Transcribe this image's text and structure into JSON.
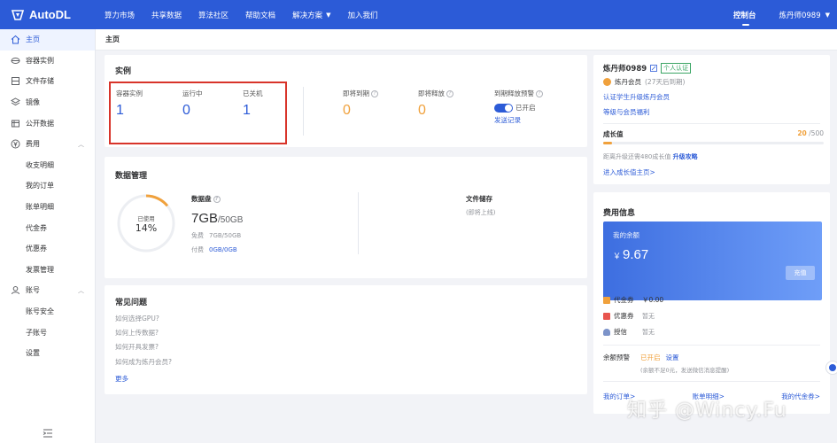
{
  "app": {
    "name": "AutoDL"
  },
  "nav": [
    "算力市场",
    "共享数据",
    "算法社区",
    "帮助文档",
    "解决方案",
    "加入我们"
  ],
  "topbar": {
    "console": "控制台",
    "user": "炼丹师0989"
  },
  "sidebar": {
    "items": [
      {
        "label": "主页",
        "icon": "home-icon"
      },
      {
        "label": "容器实例",
        "icon": "container-icon"
      },
      {
        "label": "文件存储",
        "icon": "storage-icon"
      },
      {
        "label": "镜像",
        "icon": "image-icon"
      },
      {
        "label": "公开数据",
        "icon": "database-icon"
      },
      {
        "label": "费用",
        "icon": "yuan-icon"
      },
      {
        "label": "收支明细"
      },
      {
        "label": "我的订单"
      },
      {
        "label": "账单明细"
      },
      {
        "label": "代金券"
      },
      {
        "label": "优惠券"
      },
      {
        "label": "发票管理"
      },
      {
        "label": "账号",
        "icon": "user-icon"
      },
      {
        "label": "账号安全"
      },
      {
        "label": "子账号"
      },
      {
        "label": "设置"
      }
    ]
  },
  "breadcrumb": "主页",
  "instance": {
    "title": "实例",
    "stats": [
      {
        "label": "容器实例",
        "value": "1"
      },
      {
        "label": "运行中",
        "value": "0"
      },
      {
        "label": "已关机",
        "value": "1"
      },
      {
        "label": "即将到期",
        "value": "0"
      },
      {
        "label": "即将释放",
        "value": "0"
      }
    ],
    "expire_alert": {
      "label": "到期释放预警",
      "switch_text": "已开启",
      "link": "发送记录",
      "enabled": true
    }
  },
  "data_mgmt": {
    "title": "数据管理",
    "used_label": "已使用",
    "used_percent": "14%",
    "used_fraction": 0.14,
    "disk": {
      "title": "数据盘",
      "size": "7GB",
      "total": "/50GB",
      "free_label": "免费",
      "free_value": "7GB/50GB",
      "paid_label": "付费",
      "paid_value": "0GB/0GB"
    },
    "file_storage": {
      "title": "文件储存",
      "subtitle": "(即将上线)"
    }
  },
  "faq": {
    "title": "常见问题",
    "items": [
      "如何选择GPU?",
      "如何上传数据?",
      "如何开具发票?",
      "如何成为炼丹会员?"
    ],
    "more": "更多"
  },
  "profile": {
    "name": "炼丹师0989",
    "tag": "个人认证",
    "level": "炼丹会员",
    "level_days": "(27天后到期)",
    "link1": "认证学生升级炼丹会员",
    "link2": "等级与会员福利",
    "growth_title": "成长值",
    "growth_current": "20",
    "growth_total": " /500",
    "growth_fraction": 0.04,
    "growth_tip": "距离升级还需480成长值",
    "growth_tip_link": "升级攻略",
    "growth_link": "进入成长值主页>"
  },
  "fee": {
    "title": "费用信息",
    "balance_label": "我的余额",
    "balance_yen": "￥",
    "balance_value": "9.67",
    "recharge": "充值",
    "rows": [
      {
        "name": "代金券",
        "value": "￥0.00"
      },
      {
        "name": "优惠券",
        "value": "暂无"
      },
      {
        "name": "授信",
        "value": "暂无"
      }
    ],
    "alert_label": "余额预警",
    "alert_state": "已开启",
    "alert_link": "设置",
    "alert_note": "(余额不足0元，发送微信消息提醒)",
    "bottom_links": [
      "我的订单>",
      "账单明细>",
      "我的代金券>"
    ]
  },
  "watermark": "知乎 @Wincy.Fu",
  "colors": {
    "primary": "#2c5bd7",
    "accent": "#f0a13c",
    "highlight_box": "#d8342a"
  }
}
